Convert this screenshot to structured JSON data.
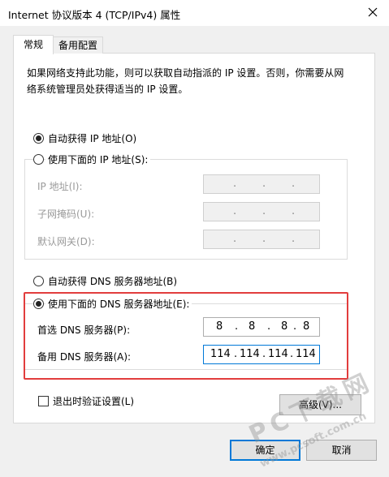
{
  "window": {
    "title": "Internet 协议版本 4 (TCP/IPv4) 属性"
  },
  "tabs": [
    {
      "label": "常规"
    },
    {
      "label": "备用配置"
    }
  ],
  "description": "如果网络支持此功能，则可以获取自动指派的 IP 设置。否则，你需要从网络系统管理员处获得适当的 IP 设置。",
  "ip_section": {
    "auto_label": "自动获得 IP 地址(O)",
    "manual_label": "使用下面的 IP 地址(S):",
    "selected": "auto",
    "fields": [
      {
        "label": "IP 地址(I):"
      },
      {
        "label": "子网掩码(U):"
      },
      {
        "label": "默认网关(D):"
      }
    ],
    "separator": "."
  },
  "dns_section": {
    "auto_label": "自动获得 DNS 服务器地址(B)",
    "manual_label": "使用下面的 DNS 服务器地址(E):",
    "selected": "manual",
    "preferred": {
      "label": "首选 DNS 服务器(P):",
      "octets": [
        "8",
        "8",
        "8",
        "8"
      ]
    },
    "alternate": {
      "label": "备用 DNS 服务器(A):",
      "octets": [
        "114",
        "114",
        "114",
        "114"
      ]
    },
    "separator": "."
  },
  "validate_checkbox": {
    "label": "退出时验证设置(L)",
    "checked": false
  },
  "buttons": {
    "advanced": "高级(V)...",
    "ok": "确定",
    "cancel": "取消"
  },
  "watermark": {
    "text": "PC下载网",
    "url": "www.pcsoft.com.cn"
  },
  "colors": {
    "highlight_border": "#e23d3d",
    "focus_blue": "#0078d7",
    "disabled_text": "#9a9a9a",
    "dialog_bg": "#f0f0f0"
  },
  "icons": {
    "close": "close-icon"
  }
}
